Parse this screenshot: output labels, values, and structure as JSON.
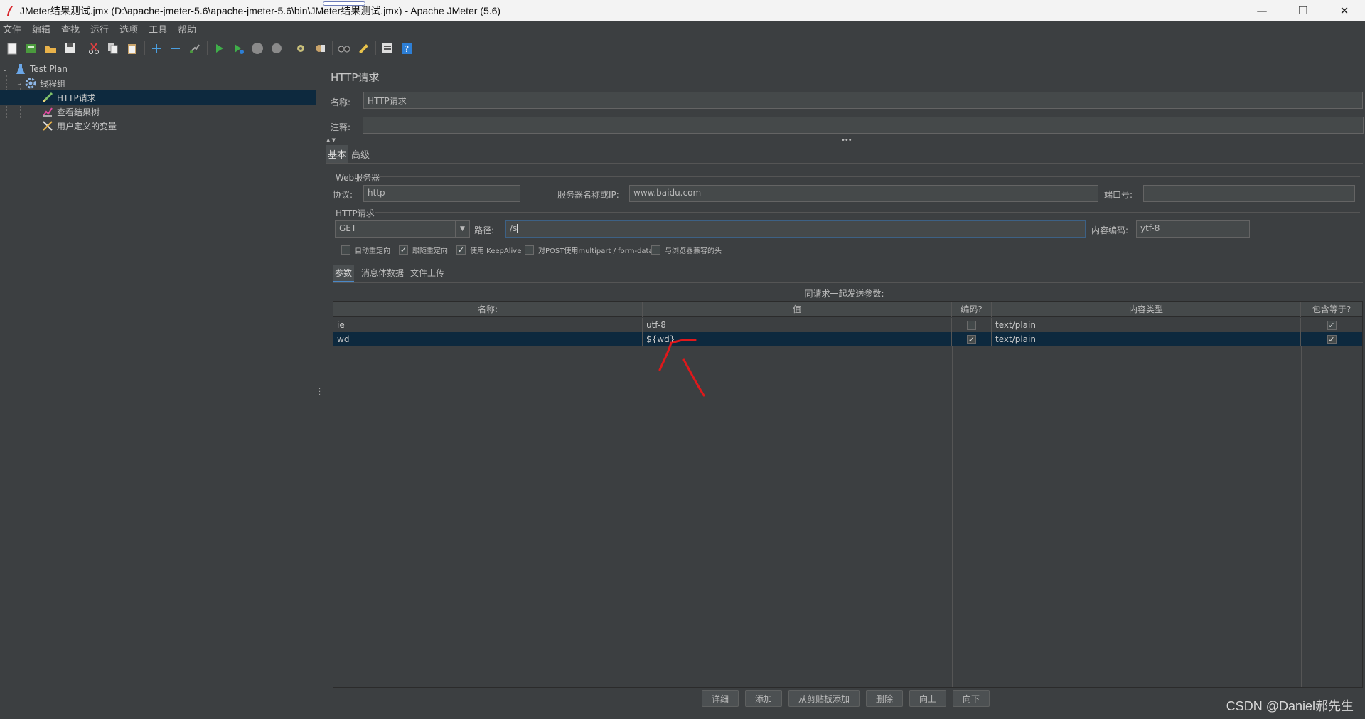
{
  "window": {
    "title": "JMeter结果测试.jmx (D:\\apache-jmeter-5.6\\apache-jmeter-5.6\\bin\\JMeter结果测试.jmx) - Apache JMeter (5.6)",
    "minimize": "—",
    "maximize": "❐",
    "close": "✕"
  },
  "menu": [
    "文件",
    "编辑",
    "查找",
    "运行",
    "选项",
    "工具",
    "帮助"
  ],
  "toolbar": {
    "icons": [
      "new-icon",
      "templates-icon",
      "open-icon",
      "save-icon",
      "cut-icon",
      "copy-icon",
      "paste-icon",
      "expand-icon",
      "collapse-icon",
      "toggle-icon",
      "start-icon",
      "start-no-pause-icon",
      "stop-icon",
      "shutdown-icon",
      "clear-icon",
      "clear-all-icon",
      "search-icon",
      "reset-search-icon",
      "function-helper-icon",
      "help-icon"
    ]
  },
  "tree": {
    "items": [
      {
        "label": "Test Plan",
        "icon": "test-plan-icon"
      },
      {
        "label": "线程组",
        "icon": "thread-group-icon"
      },
      {
        "label": "HTTP请求",
        "icon": "sampler-icon"
      },
      {
        "label": "查看结果树",
        "icon": "listener-icon"
      },
      {
        "label": "用户定义的变量",
        "icon": "config-icon"
      }
    ]
  },
  "panel": {
    "title": "HTTP请求",
    "name_label": "名称:",
    "name_value": "HTTP请求",
    "comment_label": "注释:",
    "comment_value": "",
    "tabs": [
      "基本",
      "高级"
    ],
    "web_server": {
      "legend": "Web服务器",
      "protocol_label": "协议:",
      "protocol_value": "http",
      "server_label": "服务器名称或IP:",
      "server_value": "www.baidu.com",
      "port_label": "端口号:",
      "port_value": ""
    },
    "http_request": {
      "legend": "HTTP请求",
      "method": "GET",
      "path_label": "路径:",
      "path_value": "/s",
      "encoding_label": "内容编码:",
      "encoding_value": "ytf-8"
    },
    "options": [
      {
        "label": "自动重定向",
        "checked": false
      },
      {
        "label": "跟随重定向",
        "checked": true
      },
      {
        "label": "使用 KeepAlive",
        "checked": true
      },
      {
        "label": "对POST使用multipart / form-data",
        "checked": false
      },
      {
        "label": "与浏览器兼容的头",
        "checked": false
      }
    ],
    "sub_tabs": [
      "参数",
      "消息体数据",
      "文件上传"
    ],
    "table_caption": "同请求一起发送参数:",
    "table": {
      "headers": [
        "名称:",
        "值",
        "编码?",
        "内容类型",
        "包含等于?"
      ],
      "rows": [
        {
          "name": "ie",
          "value": "utf-8",
          "encode": false,
          "content_type": "text/plain",
          "include_equals": true
        },
        {
          "name": "wd",
          "value": "${wd}",
          "encode": true,
          "content_type": "text/plain",
          "include_equals": true
        }
      ]
    },
    "buttons": [
      "详细",
      "添加",
      "从剪贴板添加",
      "删除",
      "向上",
      "向下"
    ]
  },
  "watermark": "CSDN @Daniel郝先生",
  "accent": "#4a88c7",
  "annotation_color": "#e0181b"
}
